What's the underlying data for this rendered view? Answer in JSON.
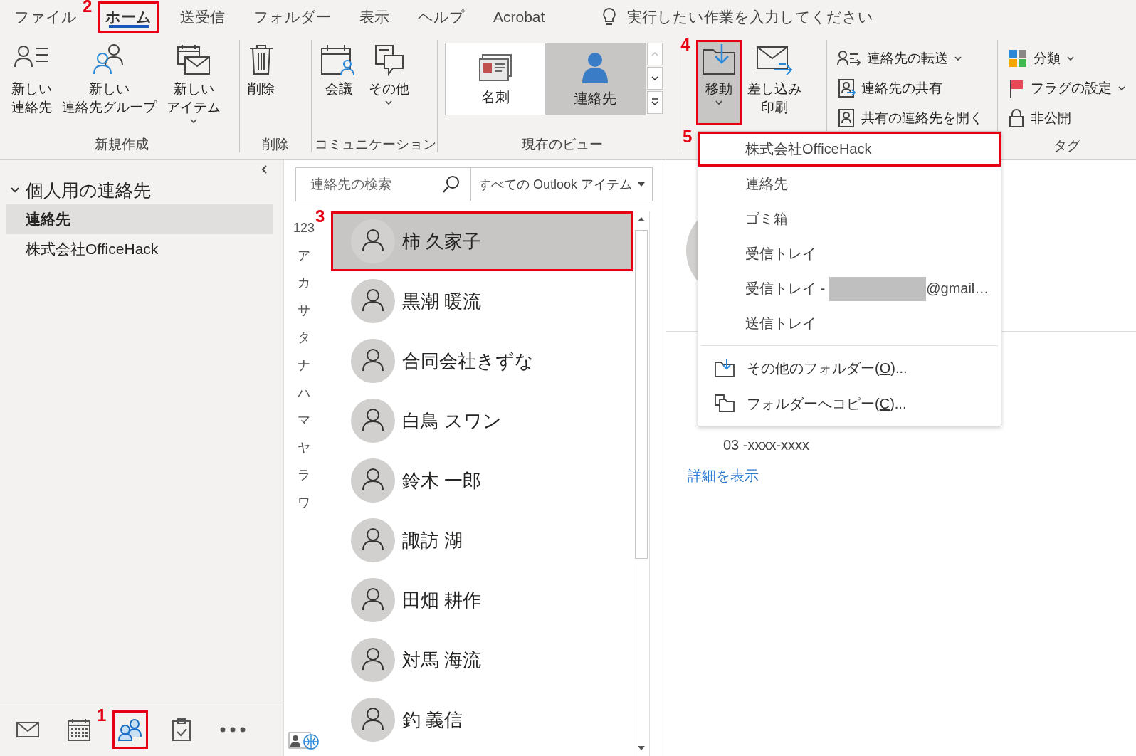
{
  "menu_tabs": [
    {
      "label": "ファイル",
      "selected": false
    },
    {
      "label": "ホーム",
      "selected": true,
      "step": "2"
    },
    {
      "label": "送受信",
      "selected": false
    },
    {
      "label": "フォルダー",
      "selected": false
    },
    {
      "label": "表示",
      "selected": false
    },
    {
      "label": "ヘルプ",
      "selected": false
    },
    {
      "label": "Acrobat",
      "selected": false
    }
  ],
  "tell_me": {
    "placeholder": "実行したい作業を入力してください"
  },
  "ribbon": [
    {
      "title": "新規作成",
      "items": [
        {
          "kind": "large",
          "label_lines": [
            "新しい",
            "連絡先"
          ]
        },
        {
          "kind": "large",
          "label_lines": [
            "新しい",
            "連絡先グループ"
          ]
        },
        {
          "kind": "large",
          "label_lines": [
            "新しい",
            "アイテム"
          ],
          "dropdown": true
        }
      ]
    },
    {
      "title": "削除",
      "items": [
        {
          "kind": "large",
          "label": "削除"
        }
      ]
    },
    {
      "title": "コミュニケーション",
      "items": [
        {
          "kind": "large",
          "label": "会議"
        },
        {
          "kind": "large",
          "label": "その他",
          "dropdown": true
        }
      ]
    },
    {
      "title": "現在のビュー",
      "items": [
        {
          "kind": "gallery",
          "options": [
            {
              "label": "名刺",
              "selected": false
            },
            {
              "label": "連絡先",
              "selected": true
            }
          ]
        }
      ]
    },
    {
      "items": [
        {
          "kind": "large",
          "label": "移動",
          "dropdown": true,
          "expanded": true,
          "step": "4"
        },
        {
          "kind": "large",
          "label_lines": [
            "差し込み",
            "印刷"
          ]
        }
      ]
    },
    {
      "items": [
        {
          "kind": "small",
          "label": "連絡先の転送",
          "dropdown": true
        },
        {
          "kind": "small",
          "label": "連絡先の共有"
        },
        {
          "kind": "small",
          "label": "共有の連絡先を開く"
        }
      ]
    },
    {
      "title": "タグ",
      "items": [
        {
          "kind": "small",
          "label": "分類",
          "dropdown": true
        },
        {
          "kind": "small",
          "label": "フラグの設定",
          "dropdown": true
        },
        {
          "kind": "small",
          "label": "非公開"
        }
      ]
    }
  ],
  "nav_pane": {
    "folders": [
      {
        "label": "個人用の連絡先",
        "expanded": true,
        "children": [
          {
            "label": "連絡先",
            "selected": true
          },
          {
            "label": "株式会社OfficeHack",
            "selected": false
          }
        ]
      }
    ]
  },
  "bottom_nav": [
    {
      "selected": false
    },
    {
      "selected": false
    },
    {
      "selected": true,
      "step": "1"
    },
    {
      "selected": false
    },
    {
      "selected": false
    }
  ],
  "search": {
    "placeholder": "連絡先の検索",
    "scope": "すべての Outlook アイテム"
  },
  "index_letters": [
    "123",
    "ア",
    "カ",
    "サ",
    "タ",
    "ナ",
    "ハ",
    "マ",
    "ヤ",
    "ラ",
    "ワ"
  ],
  "contacts": [
    {
      "name": "柿 久家子",
      "selected": true,
      "step": "3"
    },
    {
      "name": "黒潮 暖流",
      "selected": false
    },
    {
      "name": "合同会社きずな",
      "selected": false
    },
    {
      "name": "白鳥 スワン",
      "selected": false
    },
    {
      "name": "鈴木 一郎",
      "selected": false
    },
    {
      "name": "諏訪 湖",
      "selected": false
    },
    {
      "name": "田畑 耕作",
      "selected": false
    },
    {
      "name": "対馬 海流",
      "selected": false
    },
    {
      "name": "釣 義信",
      "selected": false
    }
  ],
  "move_menu": {
    "folders": [
      {
        "label": "株式会社OfficeHack",
        "step": "5"
      },
      {
        "label": "連絡先"
      },
      {
        "label": "ゴミ箱"
      },
      {
        "label": "受信トレイ"
      },
      {
        "label": "受信トレイ -",
        "redacted": true,
        "suffix": "@gmail…"
      },
      {
        "label": "送信トレイ"
      }
    ],
    "commands": [
      {
        "before": "その他のフォルダー(",
        "key": "O",
        "after": ")..."
      },
      {
        "before": "フォルダーへコピー(",
        "key": "C",
        "after": ")..."
      }
    ]
  },
  "reading_pane": {
    "phone": "03 -xxxx-xxxx",
    "details_link": "詳細を表示"
  }
}
